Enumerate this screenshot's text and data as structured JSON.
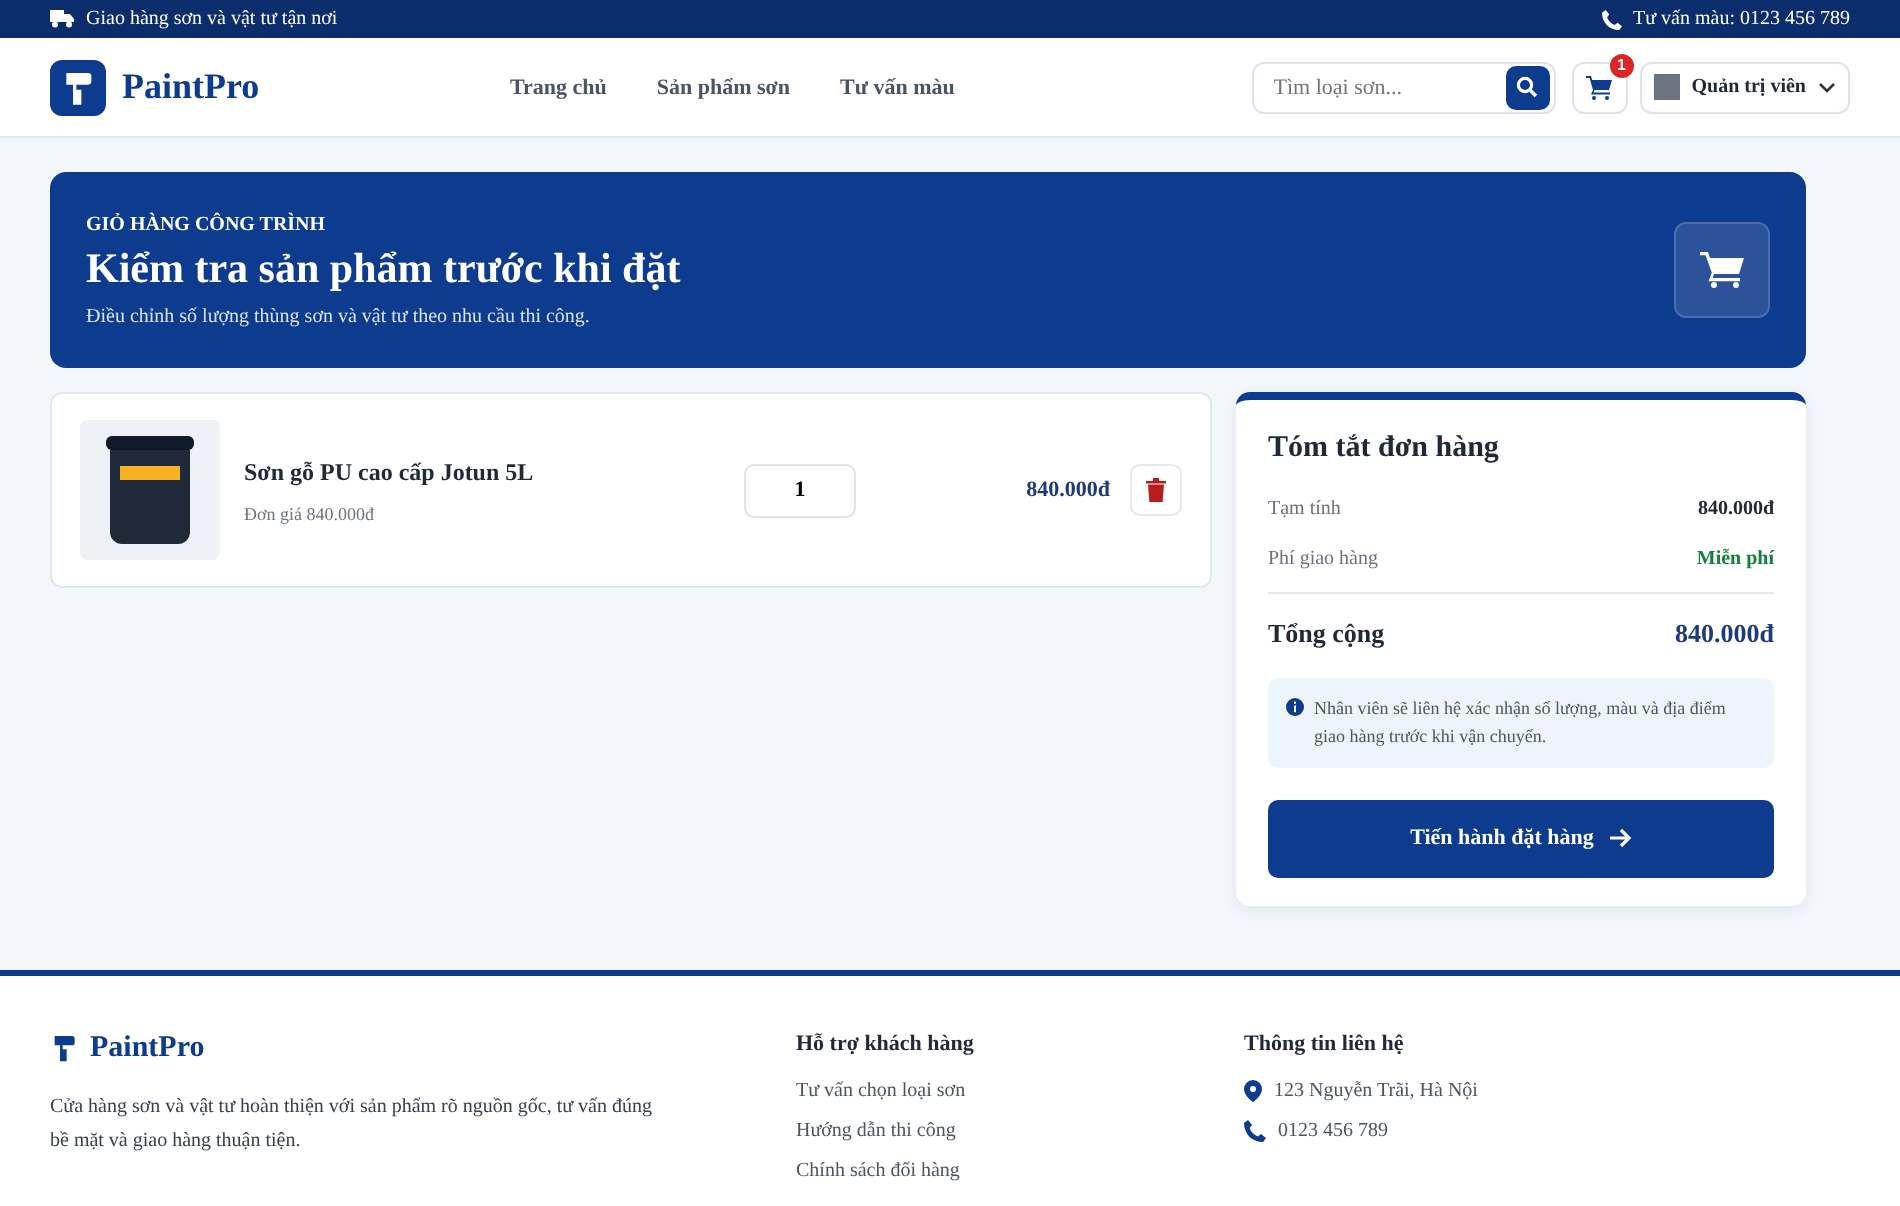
{
  "top_bar": {
    "shipping_note": "Giao hàng sơn và vật tư tận nơi",
    "hotline": "Tư vấn màu: 0123 456 789"
  },
  "header": {
    "brand": "PaintPro",
    "nav": [
      {
        "label": "Trang chủ",
        "selected": false
      },
      {
        "label": "Sản phẩm sơn",
        "selected": false
      },
      {
        "label": "Tư vấn màu",
        "selected": false
      }
    ],
    "search": {
      "placeholder": "Tìm loại sơn..."
    },
    "cart_count": "1",
    "user": "Quản trị viên"
  },
  "hero": {
    "eyebrow": "GIỎ HÀNG CÔNG TRÌNH",
    "title": "Kiểm tra sản phẩm trước khi đặt",
    "subtitle": "Điều chỉnh số lượng thùng sơn và vật tư theo nhu cầu thi công."
  },
  "cart_items": [
    {
      "name": "Sơn gỗ PU cao cấp Jotun 5L",
      "unit_price": "Đơn giá 840.000đ",
      "quantity": "1",
      "total": "840.000đ"
    }
  ],
  "summary": {
    "title": "Tóm tắt đơn hàng",
    "rows": [
      {
        "label": "Tạm tính",
        "value": "840.000đ",
        "kind": "normal"
      },
      {
        "label": "Phí giao hàng",
        "value": "Miễn phí",
        "kind": "free"
      }
    ],
    "total_label": "Tổng cộng",
    "total_value": "840.000đ",
    "note": "Nhân viên sẽ liên hệ xác nhận số lượng, màu và địa điểm giao hàng trước khi vận chuyển.",
    "checkout_button": "Tiến hành đặt hàng"
  },
  "footer": {
    "brand": "PaintPro",
    "description": "Cửa hàng sơn và vật tư hoàn thiện với sản phẩm rõ nguồn gốc, tư vấn đúng bề mặt và giao hàng thuận tiện.",
    "support": {
      "title": "Hỗ trợ khách hàng",
      "links": [
        "Tư vấn chọn loại sơn",
        "Hướng dẫn thi công",
        "Chính sách đổi hàng"
      ]
    },
    "contact": {
      "title": "Thông tin liên hệ",
      "items": [
        {
          "kind": "address",
          "text": "123 Nguyễn Trãi, Hà Nội"
        },
        {
          "kind": "phone",
          "text": "0123 456 789"
        }
      ]
    }
  }
}
